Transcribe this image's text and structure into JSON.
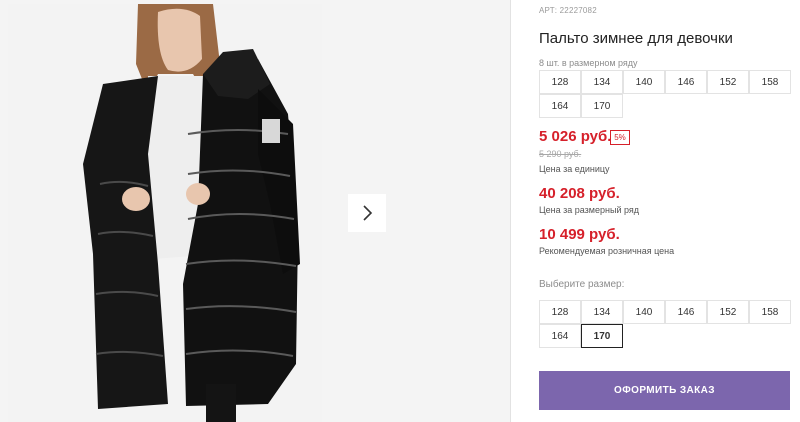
{
  "product": {
    "sku": "АРТ: 22227082",
    "title": "Пальто зимнее для девочки"
  },
  "size_row": {
    "hint": "8 шт. в размерном ряду",
    "sizes": [
      "128",
      "134",
      "140",
      "146",
      "152",
      "158",
      "164",
      "170"
    ]
  },
  "pricing": {
    "unit_price": "5 026 руб.",
    "discount_badge": "5%",
    "old_price": "5 290 руб.",
    "unit_caption": "Цена за единицу",
    "row_price": "40 208 руб.",
    "row_caption": "Цена за размерный ряд",
    "retail_price": "10 499 руб.",
    "retail_caption": "Рекомендуемая розничная цена"
  },
  "size_select": {
    "hint": "Выберите размер:",
    "sizes": [
      "128",
      "134",
      "140",
      "146",
      "152",
      "158",
      "164",
      "170"
    ],
    "selected": "170"
  },
  "actions": {
    "order_label": "ОФОРМИТЬ ЗАКАЗ"
  },
  "colors": {
    "accent": "#7c66ad",
    "price_red": "#d6202a"
  },
  "icons": {
    "next": "chevron-right-icon"
  }
}
